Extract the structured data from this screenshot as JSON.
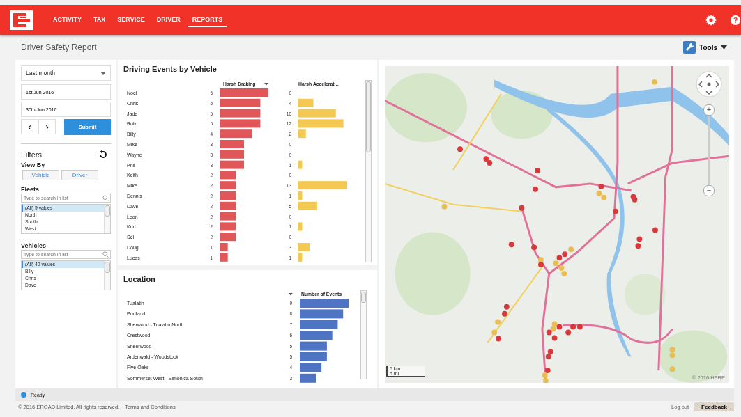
{
  "nav": {
    "items": [
      {
        "label": "ACTIVITY",
        "selected": false
      },
      {
        "label": "TAX",
        "selected": false
      },
      {
        "label": "SERVICE",
        "selected": false
      },
      {
        "label": "DRIVER",
        "selected": false
      },
      {
        "label": "REPORTS",
        "selected": true
      }
    ],
    "help": "?"
  },
  "page": {
    "title": "Driver Safety Report",
    "tools": "Tools"
  },
  "sidebar": {
    "period": "Last month",
    "from": "1st Jun 2016",
    "to": "30th Jun 2016",
    "prev": "‹",
    "next": "›",
    "submit": "Submit",
    "filters_title": "Filters",
    "view_by": "View By",
    "view_options": [
      {
        "label": "Vehicle",
        "selected": false
      },
      {
        "label": "Driver",
        "selected": false
      }
    ],
    "lists": [
      {
        "title": "Fleets",
        "placeholder": "Type to search in list",
        "items": [
          {
            "label": "(All) 9 values",
            "selected": true
          },
          {
            "label": "North",
            "selected": false
          },
          {
            "label": "South",
            "selected": false
          },
          {
            "label": "West",
            "selected": false
          }
        ]
      },
      {
        "title": "Vehicles",
        "placeholder": "Type to search in list",
        "items": [
          {
            "label": "(All) 40 values",
            "selected": true
          },
          {
            "label": "Billy",
            "selected": false
          },
          {
            "label": "Chris",
            "selected": false
          },
          {
            "label": "Dave",
            "selected": false
          }
        ]
      }
    ]
  },
  "vehicle_panel": {
    "title": "Driving Events by Vehicle",
    "chart_data": {
      "type": "bar",
      "orientation": "horizontal",
      "data_labels": true,
      "categories": [
        "Noel",
        "Chris",
        "Jade",
        "Rob",
        "Billy",
        "Mike",
        "Wayne",
        "Phil",
        "Keith",
        "Mike",
        "Dennis",
        "Dave",
        "Leon",
        "Kurt",
        "Sel",
        "Doug",
        "Lucas"
      ],
      "series": [
        {
          "name": "Harsh Braking",
          "color": "#e05659",
          "values": [
            6,
            5,
            5,
            5,
            4,
            3,
            3,
            3,
            2,
            2,
            2,
            2,
            2,
            2,
            2,
            1,
            1
          ]
        }
      ]
    },
    "acceleration": {
      "chart_data": {
        "type": "bar",
        "orientation": "horizontal",
        "data_labels": true,
        "series": [
          {
            "name": "Harsh Accelerati...",
            "color": "#f3c954",
            "values": [
              0,
              4,
              10,
              12,
              2,
              0,
              0,
              1,
              0,
              13,
              1,
              5,
              0,
              1,
              0,
              3,
              1
            ]
          }
        ]
      }
    }
  },
  "location_panel": {
    "title": "Location",
    "chart_data": {
      "type": "bar",
      "orientation": "horizontal",
      "data_labels": true,
      "categories": [
        "Tualatin",
        "Portland",
        "Sherwood - Tualatin North",
        "Crestwood",
        "Sheerwood",
        "Ardenwald - Woodstock",
        "Five Oaks",
        "Sommerset West - Elmonica South"
      ],
      "series": [
        {
          "name": "Number of Events",
          "color": "#4f74c4",
          "values": [
            9,
            8,
            7,
            6,
            5,
            5,
            4,
            3
          ]
        }
      ]
    }
  },
  "map": {
    "scale_km": "5 km",
    "scale_mi": "5 mi",
    "copyright": "© 2016 HERE",
    "zoom_in": "+",
    "zoom_out": "−"
  },
  "status_bar": {
    "text": "Ready"
  },
  "footer": {
    "copyright": "© 2016 EROAD Limited. All rights reserved.",
    "terms": "Terms and Conditions",
    "logout": "Log out",
    "feedback": "Feedback"
  }
}
